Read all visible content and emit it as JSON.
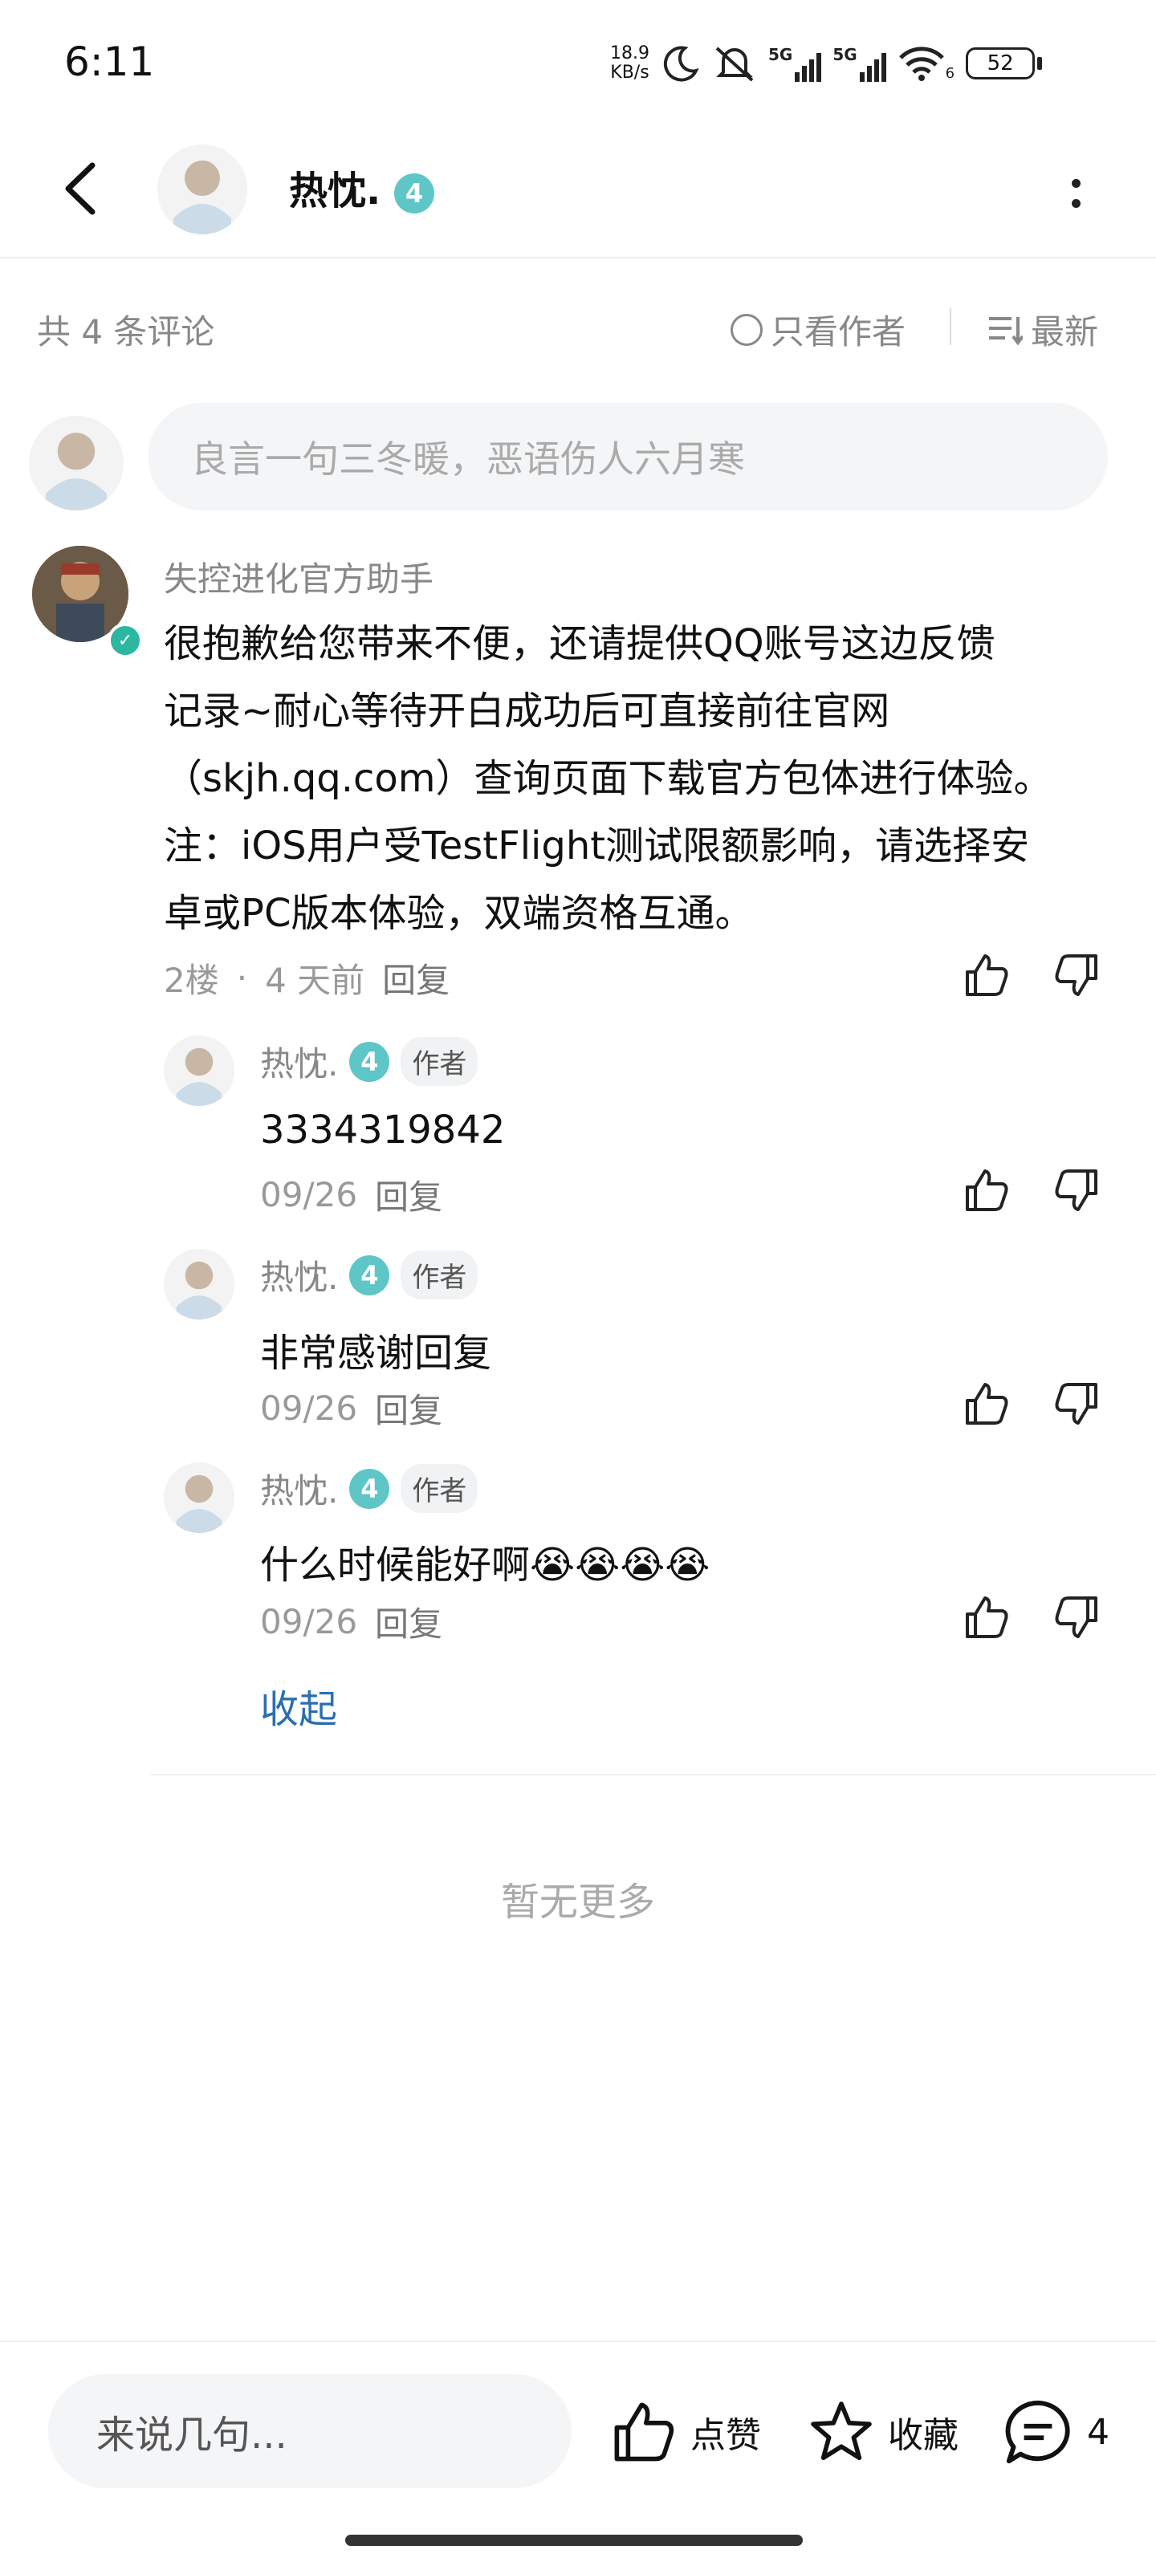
{
  "status_bar": {
    "time": "6:11",
    "net_speed_value": "18.9",
    "net_speed_unit": "KB/s",
    "signal_label_1": "5G",
    "signal_label_2": "5G",
    "wifi_sub": "6",
    "battery": "52"
  },
  "header": {
    "back_icon": "chevron-left-icon",
    "name": "热忱.",
    "level": "4",
    "more_icon": "more-vertical-icon"
  },
  "filter": {
    "count_text": "共 4 条评论",
    "only_author_label": "只看作者",
    "sort_label": "最新"
  },
  "composer": {
    "placeholder": "良言一句三冬暖，恶语伤人六月寒"
  },
  "main_comment": {
    "author": "失控进化官方助手",
    "lines": [
      "很抱歉给您带来不便，还请提供QQ账号这边反馈",
      "记录~耐心等待开白成功后可直接前往官网",
      "（skjh.qq.com）查询页面下载官方包体进行体验。",
      "注：iOS用户受TestFlight测试限额影响，请选择安",
      "卓或PC版本体验，双端资格互通。"
    ],
    "floor": "2楼",
    "dot": "·",
    "time": "4 天前",
    "reply_label": "回复"
  },
  "replies": [
    {
      "name": "热忱.",
      "level": "4",
      "tag": "作者",
      "text": "3334319842",
      "emoji": "",
      "date": "09/26",
      "reply_label": "回复"
    },
    {
      "name": "热忱.",
      "level": "4",
      "tag": "作者",
      "text": "非常感谢回复",
      "emoji": "",
      "date": "09/26",
      "reply_label": "回复"
    },
    {
      "name": "热忱.",
      "level": "4",
      "tag": "作者",
      "text": "什么时候能好啊",
      "emoji": "😭😭😭😭",
      "date": "09/26",
      "reply_label": "回复"
    }
  ],
  "collapse_label": "收起",
  "no_more": "暂无更多",
  "bottom_bar": {
    "input_placeholder": "来说几句...",
    "like_label": "点赞",
    "favorite_label": "收藏",
    "comment_count": "4"
  },
  "colors": {
    "level_badge": "#5ec6c6",
    "link": "#2a6fb0",
    "muted": "#888888"
  }
}
